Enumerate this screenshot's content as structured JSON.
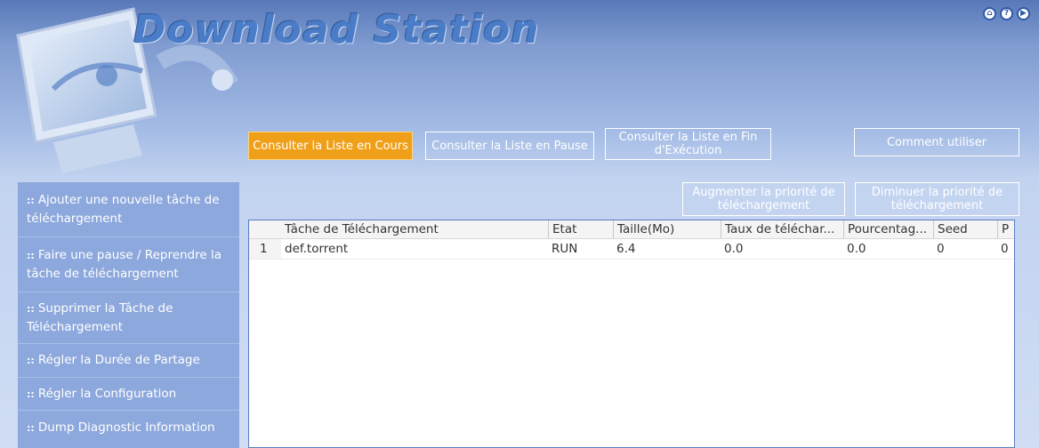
{
  "app": {
    "title": "Download Station"
  },
  "top_icons": [
    {
      "name": "home-icon",
      "glyph": "⌂"
    },
    {
      "name": "help-icon",
      "glyph": "?"
    },
    {
      "name": "next-icon",
      "glyph": "▶"
    }
  ],
  "tabs": {
    "current": "Consulter la Liste en Cours",
    "paused": "Consulter la Liste en Pause",
    "finished": "Consulter la Liste en Fin d'Exécution",
    "howto": "Comment utiliser"
  },
  "sidebar": {
    "items": [
      "Ajouter une nouvelle tâche de téléchargement",
      "Faire une pause / Reprendre la tâche de téléchargement",
      "Supprimer la Tâche de Téléchargement",
      "Régler la Durée de Partage",
      "Régler la Configuration",
      "Dump Diagnostic Information"
    ]
  },
  "actions": {
    "increase": "Augmenter la priorité de téléchargement",
    "decrease": "Diminuer la priorité de téléchargement"
  },
  "table": {
    "headers": [
      "",
      "Tâche de Téléchargement",
      "Etat",
      "Taille(Mo)",
      "Taux de téléchar...",
      "Pourcentag...",
      "Seed",
      "P"
    ],
    "rows": [
      [
        "1",
        "def.torrent",
        "RUN",
        "6.4",
        "0.0",
        "0.0",
        "0",
        "0"
      ]
    ]
  },
  "colors": {
    "accent": "#f0a018",
    "sidebar": "#8da8dc",
    "title": "#4a7cc8"
  }
}
